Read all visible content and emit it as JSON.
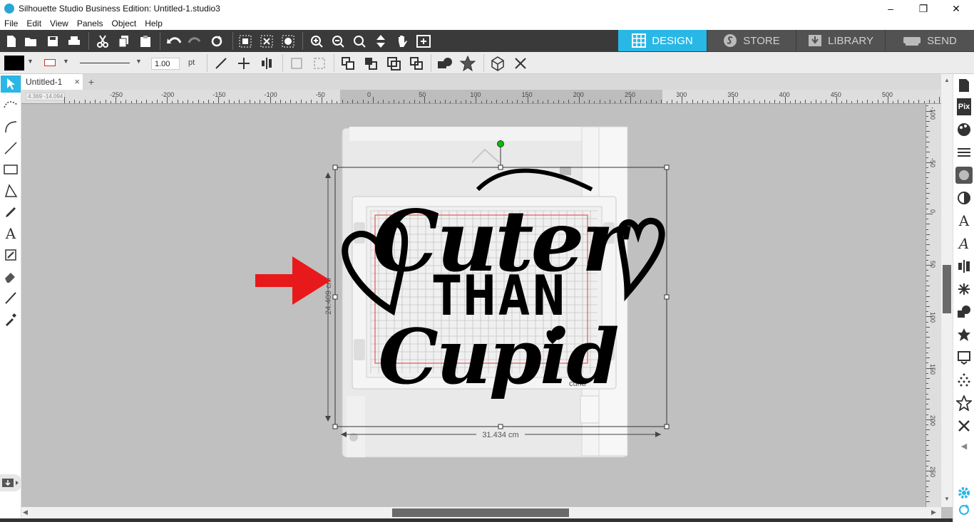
{
  "window": {
    "title": "Silhouette Studio Business Edition: Untitled-1.studio3",
    "minimize": "–",
    "restore": "❐",
    "close": "✕"
  },
  "menu": [
    "File",
    "Edit",
    "View",
    "Panels",
    "Object",
    "Help"
  ],
  "nav_tabs": [
    {
      "label": "DESIGN",
      "icon": "grid-icon",
      "active": true
    },
    {
      "label": "STORE",
      "icon": "silhouette-s-icon",
      "active": false
    },
    {
      "label": "LIBRARY",
      "icon": "library-download-icon",
      "active": false
    },
    {
      "label": "SEND",
      "icon": "cutter-icon",
      "active": false
    }
  ],
  "line_settings": {
    "width_value": "1.00",
    "unit": "pt"
  },
  "colors": {
    "accent": "#29b7e6",
    "fill_swatch": "#000000",
    "line_swatch": "#d32f2f",
    "selection_handle": "#00c000",
    "arrow": "#e8191a"
  },
  "document": {
    "tab_label": "Untitled-1",
    "close": "×",
    "new_tab": "+"
  },
  "ruler": {
    "h_labels": [
      "-250",
      "-200",
      "-150",
      "-100",
      "-50",
      "0",
      "50",
      "100",
      "150",
      "200",
      "250",
      "300",
      "350",
      "400",
      "450",
      "500"
    ],
    "v_labels": [
      "-100",
      "-50",
      "0",
      "50",
      "100",
      "150",
      "200",
      "250"
    ],
    "coord_readout": "4.369  -14.094"
  },
  "artwork": {
    "line1": "Cuter",
    "line2": "THAN",
    "line3": "Cupid"
  },
  "machine": {
    "brand_label": "curio"
  },
  "dimensions": {
    "width": "31.434 cm",
    "height": "24.409 cm"
  }
}
